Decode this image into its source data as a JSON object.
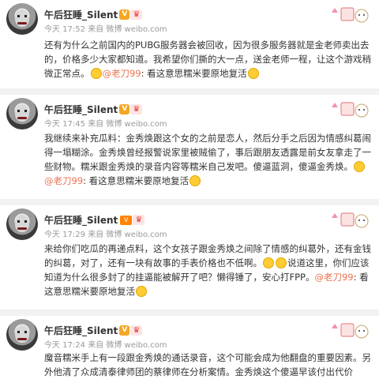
{
  "posts": [
    {
      "username": "午后狂睡_Silent",
      "time": "今天 17:52",
      "source_prefix": "来自",
      "source": "微博 weibo.com",
      "text_before": "还有为什么之前国内的PUBG服务器会被回收，因为很多服务器就是金老师卖出去的，价格多少大家都知道。我希望你们撕的大一点，送金老师一程，让这个游戏稍微正常点。",
      "mention": "@老刀99",
      "text_after": ": 看这意思糯米要原地复活"
    },
    {
      "username": "午后狂睡_Silent",
      "time": "今天 17:45",
      "source_prefix": "来自",
      "source": "微博 weibo.com",
      "text_before": "我继续来补充瓜料：金秀焕跟这个女的之前是恋人，然后分手之后因为情感纠葛闹得一塌糊涂。金秀焕曾经报警说家里被贼偷了，事后跟朋友透露是前女友拿走了一些财物。糯米跟金秀焕的录音内容等糯米自己发吧。傻逼蓝洞，傻逼金秀焕。",
      "mention": "@老刀99",
      "text_after": ": 看这意思糯米要原地复活"
    },
    {
      "username": "午后狂睡_Silent",
      "time": "今天 17:29",
      "source_prefix": "来自",
      "source": "微博 weibo.com",
      "text_before": "来给你们吃瓜的再递点料，这个女孩子跟金秀焕之间除了情感的纠葛外，还有金钱的纠葛，对了，还有一块有故事的手表价格也不低啊。",
      "text_mid": "说道这里，你们应该知道为什么很多封了的挂逼能被解开了吧？懒得锤了，安心打FPP。",
      "mention": "@老刀99",
      "text_after": ": 看这意思糯米要原地复活"
    },
    {
      "username": "午后狂睡_Silent",
      "time": "今天 17:24",
      "source_prefix": "来自",
      "source": "微博 weibo.com",
      "text_before": "魔音糯米手上有一段跟金秀焕的通话录音，这个可能会成为他翻盘的重要因素。另外他清了众成清泰律师团的蔡律师在分析案情。金秀焕这个傻逼早该付出代价"
    }
  ]
}
